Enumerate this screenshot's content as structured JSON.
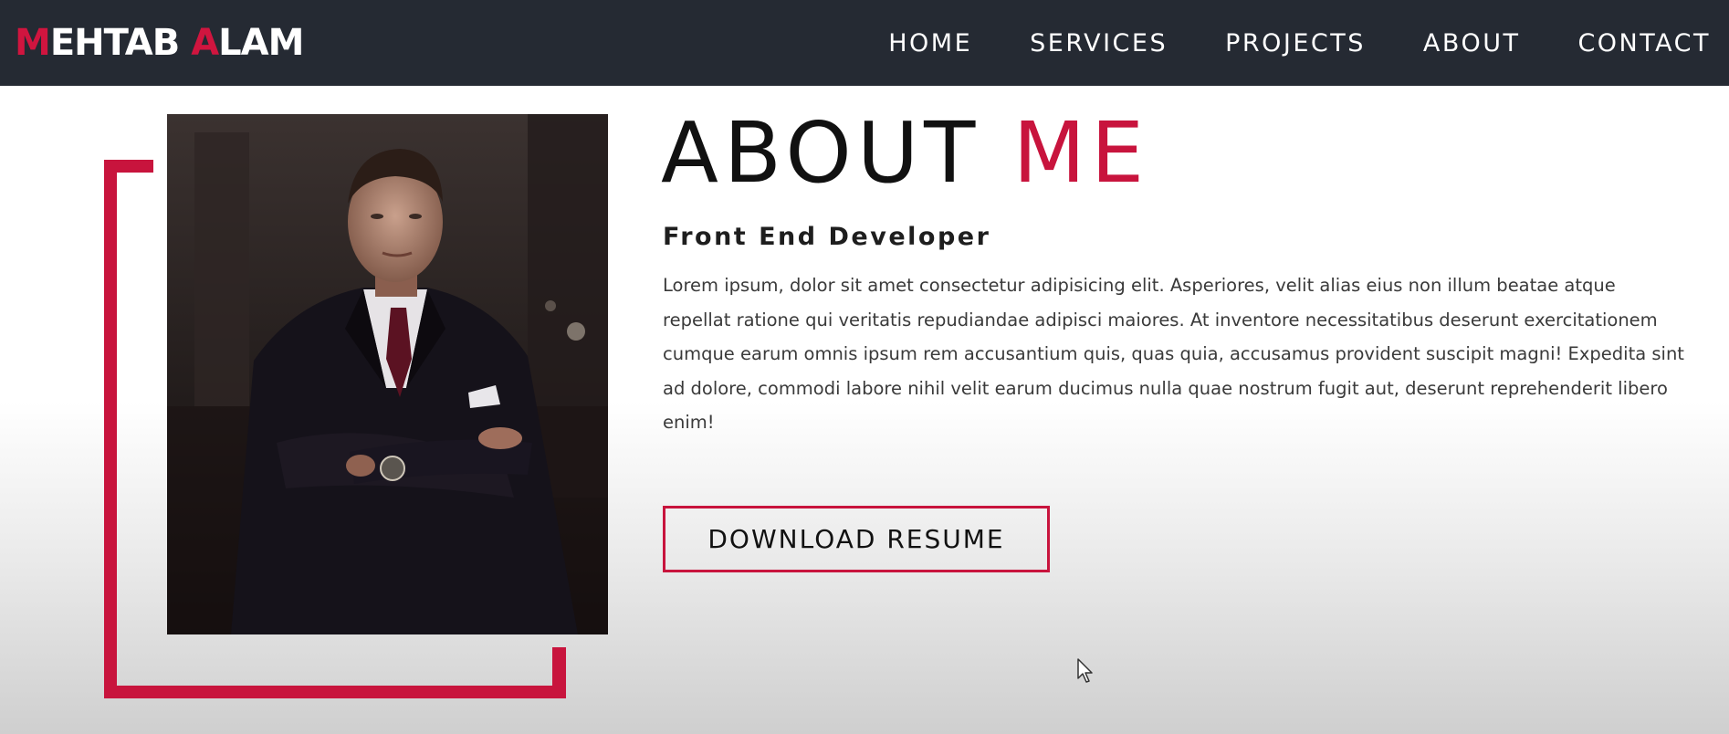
{
  "brand": {
    "first_initial": "M",
    "first_rest": "EHTAB",
    "last_initial": "A",
    "last_rest": "LAM",
    "accent_color": "#d0153f"
  },
  "nav": {
    "items": [
      {
        "label": "HOME"
      },
      {
        "label": "SERVICES"
      },
      {
        "label": "PROJECTS"
      },
      {
        "label": "ABOUT"
      },
      {
        "label": "CONTACT"
      }
    ],
    "background_color": "#252a33"
  },
  "about": {
    "heading_main": "ABOUT",
    "heading_accent": "ME",
    "subtitle": "Front End Developer",
    "bio": "Lorem ipsum, dolor sit amet consectetur adipisicing elit. Asperiores, velit alias eius non illum beatae atque repellat ratione qui veritatis repudiandae adipisci maiores. At inventore necessitatibus deserunt exercitationem cumque earum omnis ipsum rem accusantium quis, quas quia, accusamus provident suscipit magni! Expedita sint ad dolore, commodi labore nihil velit earum ducimus nulla quae nostrum fugit aut, deserunt reprehenderit libero enim!",
    "button_label": "DOWNLOAD RESUME",
    "accent_color": "#c8143d"
  },
  "icons": {
    "cursor": "mouse-pointer-icon"
  }
}
